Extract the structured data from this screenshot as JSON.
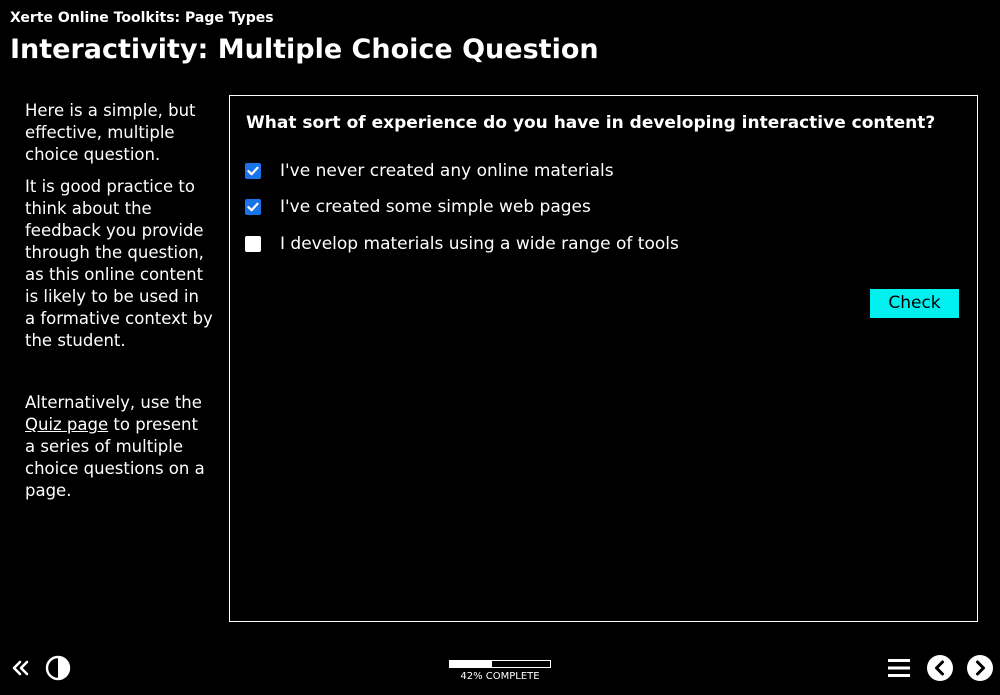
{
  "header": {
    "subtitle": "Xerte Online Toolkits: Page Types",
    "title": "Interactivity: Multiple Choice Question"
  },
  "sidebar": {
    "paragraph1": "Here is a simple, but effective, multiple choice question.",
    "paragraph2": "It is good practice to think about the feedback you provide through the question, as this online content is likely to be used in a formative context by the student.",
    "alt_before": "Alternatively, use the ",
    "alt_link": "Quiz page",
    "alt_after": " to present a series of multiple choice questions on a page."
  },
  "question": {
    "text": "What sort of experience do you have in developing interactive content?",
    "options": [
      {
        "label": "I've never created any online materials",
        "checked": true
      },
      {
        "label": "I've created some simple web pages",
        "checked": true
      },
      {
        "label": "I develop materials using a wide range of tools",
        "checked": false
      }
    ],
    "check_label": "Check"
  },
  "footer": {
    "progress_percent": 42,
    "progress_label": "42% COMPLETE",
    "icons": {
      "collapse": "double-chevron-left-icon",
      "contrast": "contrast-icon",
      "menu": "hamburger-menu-icon",
      "prev": "chevron-left-circle-icon",
      "next": "chevron-right-circle-icon"
    }
  },
  "colors": {
    "background": "#000000",
    "text": "#ffffff",
    "check_button": "#00f0f0",
    "checkbox_checked": "#1a73e8"
  }
}
